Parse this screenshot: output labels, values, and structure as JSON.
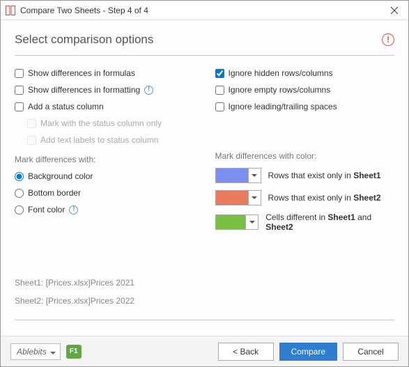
{
  "window": {
    "title": "Compare Two Sheets - Step 4 of 4"
  },
  "header": {
    "heading": "Select comparison options",
    "warn_mark": "!"
  },
  "left": {
    "diff_formulas": "Show differences in formulas",
    "diff_formatting": "Show differences in formatting",
    "add_status": "Add a status column",
    "status_only": "Mark with the status column only",
    "status_labels": "Add text labels to status column",
    "mark_with_label": "Mark differences with:",
    "radio_bg": "Background color",
    "radio_border": "Bottom border",
    "radio_font": "Font color"
  },
  "right": {
    "ignore_hidden": "Ignore hidden rows/columns",
    "ignore_empty": "Ignore empty rows/columns",
    "ignore_spaces": "Ignore leading/trailing spaces",
    "mark_color_label": "Mark differences with color:",
    "row1_pre": "Rows that exist only in ",
    "row1_b": "Sheet1",
    "row2_pre": "Rows that exist only in ",
    "row2_b": "Sheet2",
    "row3_pre": "Cells different in ",
    "row3_b1": "Sheet1",
    "row3_mid": "  and  ",
    "row3_b2": "Sheet2",
    "colors": {
      "c1": "#7b8ff0",
      "c2": "#e87a5d",
      "c3": "#79c143"
    }
  },
  "info": {
    "sheet1": "Sheet1: [Prices.xlsx]Prices 2021",
    "sheet2": "Sheet2: [Prices.xlsx]Prices 2022"
  },
  "footer": {
    "brand": "Ablebits",
    "f1": "F1",
    "back": "<  Back",
    "compare": "Compare",
    "cancel": "Cancel"
  }
}
